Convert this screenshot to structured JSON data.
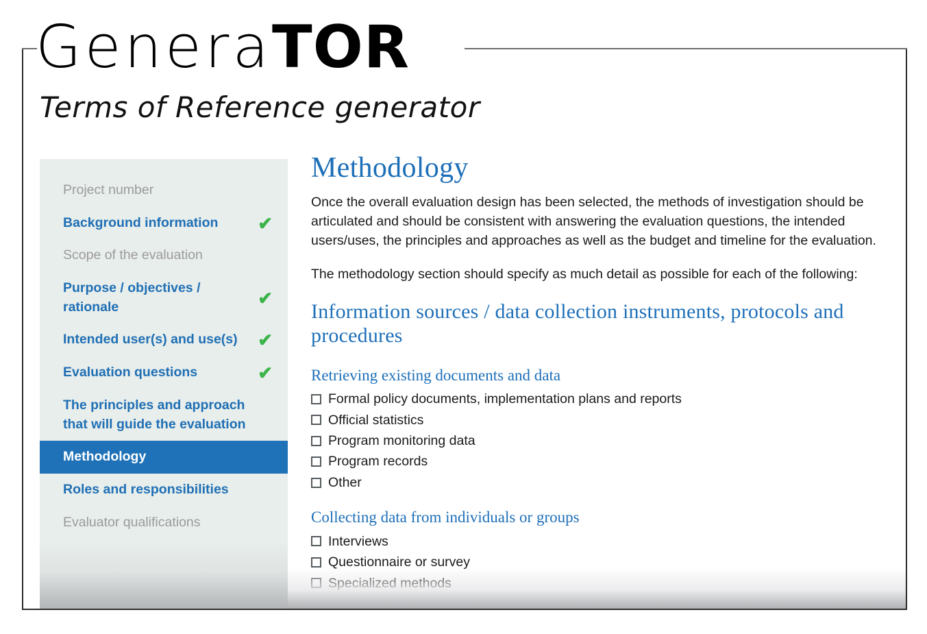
{
  "brand": {
    "logo_light": "Genera",
    "logo_bold": "TOR",
    "tagline": "Terms of Reference generator",
    "accent_blue": "#1f72b8",
    "heading_blue": "#1d6fb8",
    "check_green": "#3cb44a",
    "sidebar_bg": "#e8eeec"
  },
  "sidebar": {
    "items": [
      {
        "label": "Project number",
        "state": "disabled",
        "completed": false,
        "check": ""
      },
      {
        "label": "Background information",
        "state": "enabled",
        "completed": true,
        "check": "✔"
      },
      {
        "label": "Scope of the evaluation",
        "state": "disabled",
        "completed": false,
        "check": ""
      },
      {
        "label": "Purpose / objectives / rationale",
        "state": "enabled",
        "completed": true,
        "check": "✔"
      },
      {
        "label": "Intended user(s) and use(s)",
        "state": "enabled",
        "completed": true,
        "check": "✔"
      },
      {
        "label": "Evaluation questions",
        "state": "enabled",
        "completed": true,
        "check": "✔"
      },
      {
        "label": "The principles and approach that will guide the evaluation",
        "state": "enabled",
        "completed": false,
        "check": ""
      },
      {
        "label": "Methodology",
        "state": "active",
        "completed": false,
        "check": ""
      },
      {
        "label": "Roles and responsibilities",
        "state": "enabled",
        "completed": false,
        "check": ""
      },
      {
        "label": "Evaluator qualifications",
        "state": "disabled",
        "completed": false,
        "check": ""
      }
    ]
  },
  "main": {
    "title": "Methodology",
    "intro_paragraph": "Once the overall evaluation design has been selected, the methods of investigation should be articulated and should be consistent with answering the evaluation questions, the intended users/uses, the principles and approaches as well as the budget and timeline for the evaluation.",
    "lead_paragraph": "The methodology section should specify as much detail as possible for each of the following:",
    "section_title": "Information sources / data collection instruments, protocols and procedures",
    "groups": [
      {
        "title": "Retrieving existing documents and data",
        "options": [
          {
            "label": "Formal policy documents, implementation plans and reports",
            "checked": false
          },
          {
            "label": "Official statistics",
            "checked": false
          },
          {
            "label": "Program monitoring data",
            "checked": false
          },
          {
            "label": "Program records",
            "checked": false
          },
          {
            "label": "Other",
            "checked": false
          }
        ]
      },
      {
        "title": "Collecting data from individuals or groups",
        "options": [
          {
            "label": "Interviews",
            "checked": false
          },
          {
            "label": "Questionnaire or survey",
            "checked": false
          },
          {
            "label": "Specialized methods",
            "checked": false
          }
        ]
      }
    ]
  }
}
